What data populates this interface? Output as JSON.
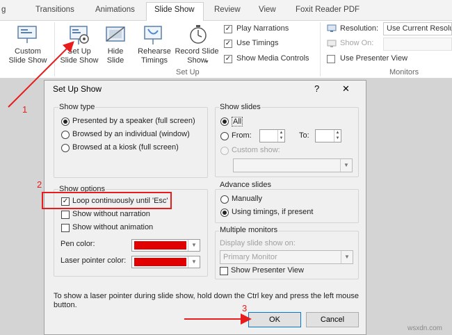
{
  "ribbon_tabs": [
    "Transitions",
    "Animations",
    "Slide Show",
    "Review",
    "View",
    "Foxit Reader PDF"
  ],
  "tab_cutoff": "g",
  "ribbon": {
    "custom_slide_show": "Custom\nSlide Show",
    "set_up_slide_show": "Set Up\nSlide Show",
    "hide_slide": "Hide\nSlide",
    "rehearse_timings": "Rehearse\nTimings",
    "record_slide_show": "Record Slide\nShow",
    "play_narrations": "Play Narrations",
    "use_timings": "Use Timings",
    "show_media_controls": "Show Media Controls",
    "setup_group_label": "Set Up",
    "resolution_label": "Resolution:",
    "resolution_value": "Use Current Resolu",
    "show_on_label": "Show On:",
    "use_presenter_view": "Use Presenter View",
    "monitors_group_label": "Monitors"
  },
  "dialog": {
    "title": "Set Up Show",
    "help": "?",
    "close": "✕",
    "show_type": {
      "title": "Show type",
      "options": [
        "Presented by a speaker (full screen)",
        "Browsed by an individual (window)",
        "Browsed at a kiosk (full screen)"
      ],
      "selected": 0
    },
    "show_options": {
      "title": "Show options",
      "loop": "Loop continuously until 'Esc'",
      "without_narration": "Show without narration",
      "without_animation": "Show without animation",
      "pen_color": "Pen color:",
      "laser_color": "Laser pointer color:",
      "pen_color_value": "#e00000",
      "laser_color_value": "#e00000"
    },
    "show_slides": {
      "title": "Show slides",
      "all": "All",
      "from": "From:",
      "to": "To:",
      "custom_show": "Custom show:"
    },
    "advance_slides": {
      "title": "Advance slides",
      "manually": "Manually",
      "using_timings": "Using timings, if present"
    },
    "multiple_monitors": {
      "title": "Multiple monitors",
      "display_on": "Display slide show on:",
      "monitor_value": "Primary Monitor",
      "presenter_view": "Show Presenter View"
    },
    "footer_note": "To show a laser pointer during slide show, hold down the Ctrl key and press the left mouse button.",
    "ok": "OK",
    "cancel": "Cancel"
  },
  "annotations": [
    "1",
    "2",
    "3"
  ],
  "watermark": "wsxdn.com",
  "colors": {
    "annotation_red": "#e81c1c",
    "swatch_red": "#e00000"
  }
}
